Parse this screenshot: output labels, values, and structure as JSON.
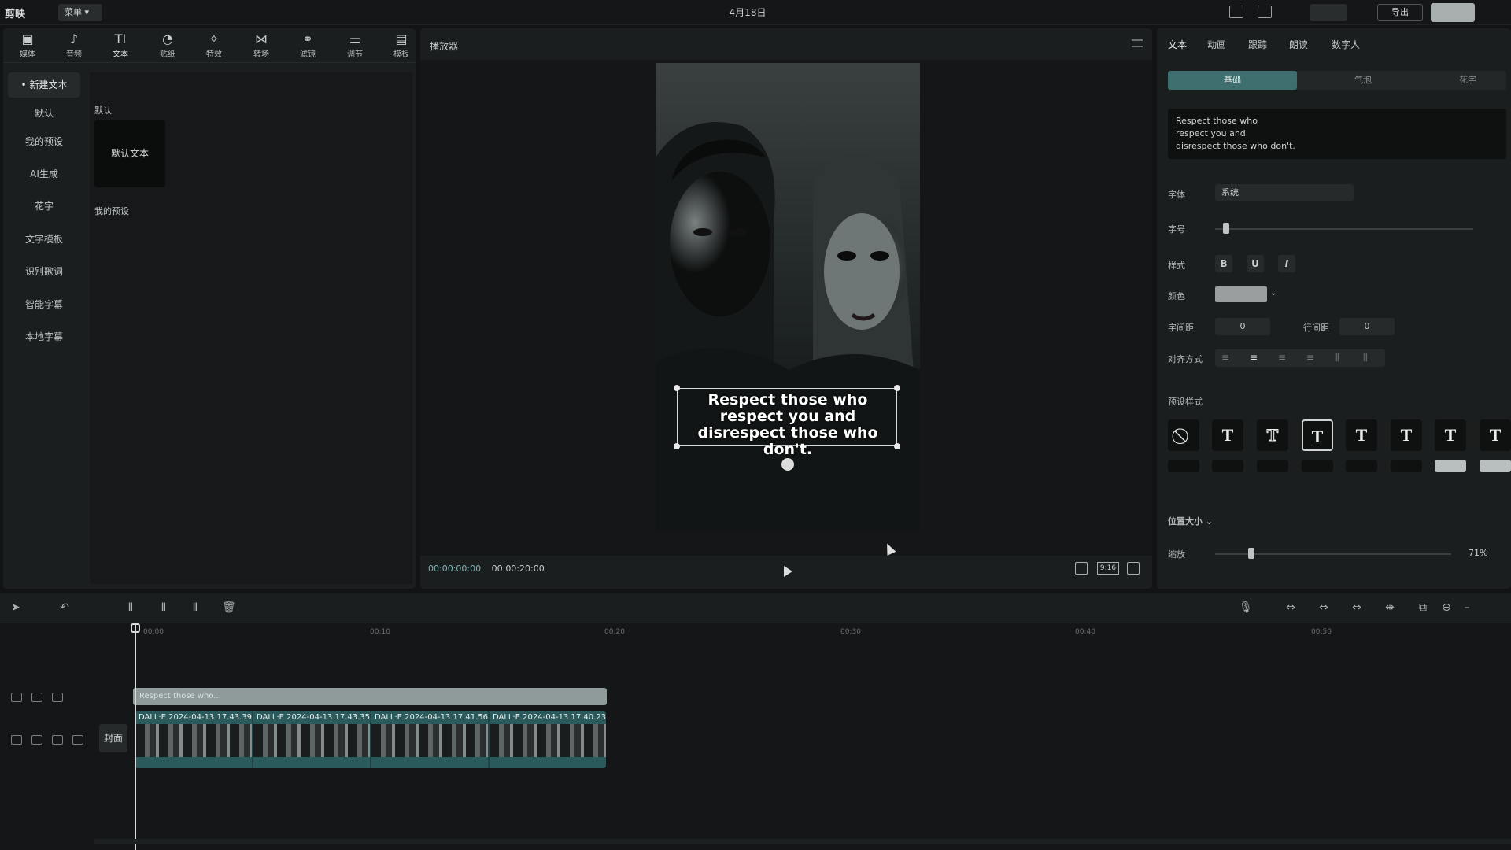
{
  "topbar": {
    "logo": "剪映",
    "menu_label": "菜单 ▾",
    "date": "4月18日",
    "export_label": "导出"
  },
  "left": {
    "tabs": [
      {
        "label": "媒体",
        "icon": "▣"
      },
      {
        "label": "音频",
        "icon": "♪"
      },
      {
        "label": "文本",
        "icon": "TI"
      },
      {
        "label": "贴纸",
        "icon": "◔"
      },
      {
        "label": "特效",
        "icon": "✧"
      },
      {
        "label": "转场",
        "icon": "⋈"
      },
      {
        "label": "滤镜",
        "icon": "⚭"
      },
      {
        "label": "调节",
        "icon": "⚌"
      },
      {
        "label": "模板",
        "icon": "▤"
      }
    ],
    "sidenav": [
      "• 新建文本",
      "默认",
      "我的预设",
      "AI生成",
      "花字",
      "文字模板",
      "识别歌词",
      "智能字幕",
      "本地字幕"
    ],
    "section_default": "默认",
    "card_default": "默认文本",
    "section_presets": "我的预设"
  },
  "player": {
    "title": "播放器",
    "caption": "Respect those who respect you and disrespect those who don't.",
    "caption_lines": [
      "Respect those who",
      "respect you and",
      "disrespect those who don't."
    ],
    "time_current": "00:00:00:00",
    "time_total": "00:00:20:00",
    "ratio": "9:16"
  },
  "right": {
    "tabs": [
      "文本",
      "动画",
      "跟踪",
      "朗读",
      "数字人"
    ],
    "segments": [
      "基础",
      "气泡",
      "花字"
    ],
    "text_value": [
      "Respect those who",
      "respect you and",
      "disrespect those who don't."
    ],
    "font_label": "字体",
    "font_value": "系统",
    "size_label": "字号",
    "style_label": "样式",
    "color_label": "颜色",
    "char_spacing_label": "字间距",
    "char_spacing_value": "0",
    "line_spacing_label": "行间距",
    "line_spacing_value": "0",
    "align_label": "对齐方式",
    "preset_label": "预设样式",
    "position_label": "位置大小 ⌄",
    "scale_label": "缩放",
    "scale_value": "71%",
    "style_buttons": [
      "B",
      "U",
      "I"
    ]
  },
  "timeline": {
    "ticks": [
      "00:00",
      "00:10",
      "00:20",
      "00:30",
      "00:40",
      "00:50"
    ],
    "text_clip": "Respect those who...",
    "cover_label": "封面",
    "clips": [
      "DALL·E 2024-04-13 17.43.39",
      "DALL·E 2024-04-13 17.43.35",
      "DALL·E 2024-04-13 17.41.56",
      "DALL·E 2024-04-13 17.40.23"
    ]
  }
}
